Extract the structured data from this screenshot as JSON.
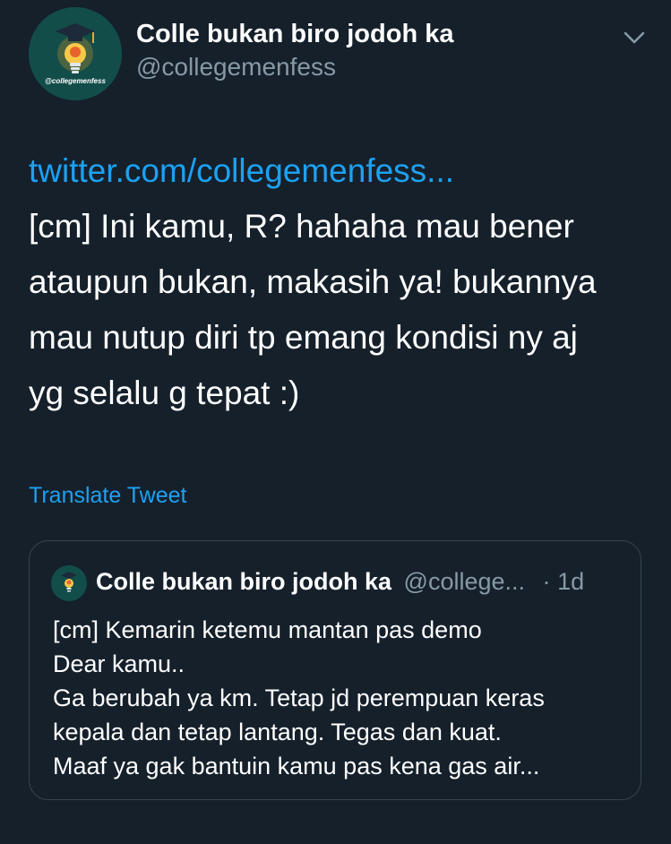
{
  "tweet": {
    "display_name": "Colle bukan biro jodoh ka",
    "handle": "@collegemenfess",
    "avatar_text": "@collegemenfess",
    "link": "twitter.com/collegemenfess...",
    "body_lines": [
      "[cm] Ini kamu, R? hahaha mau bener",
      "ataupun bukan, makasih ya! bukannya",
      "mau nutup diri tp emang kondisi ny aj",
      "yg selalu g tepat :)"
    ],
    "translate_label": "Translate Tweet",
    "menu_icon": "chevron-down-icon"
  },
  "quote": {
    "display_name": "Colle bukan biro jodoh ka",
    "handle": "@college...",
    "separator": "·",
    "time": "1d",
    "body_lines": [
      "[cm] Kemarin ketemu mantan pas demo",
      "Dear kamu..",
      "Ga berubah ya km. Tetap jd perempuan keras",
      "kepala dan tetap lantang. Tegas dan kuat.",
      "Maaf ya gak bantuin kamu pas kena gas air..."
    ]
  },
  "colors": {
    "background": "#15202b",
    "accent": "#1da1f2",
    "secondary_text": "#8899a6",
    "border": "#38444d",
    "avatar_bg": "#134d4a"
  }
}
